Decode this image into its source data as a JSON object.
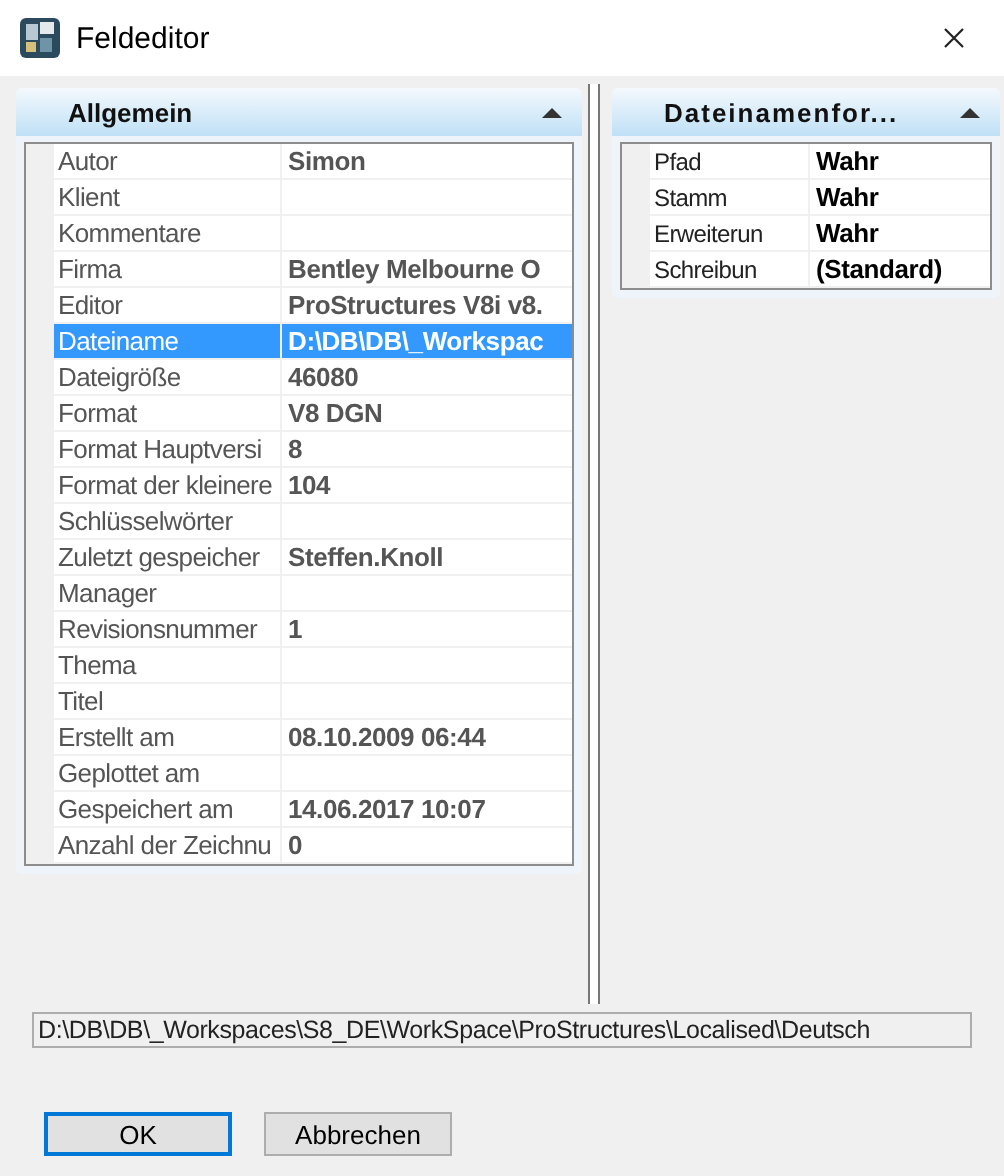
{
  "window": {
    "title": "Feldeditor"
  },
  "panels": [
    {
      "title": "Allgemein",
      "expanded": true,
      "rows": [
        {
          "label": "Autor",
          "value": "Simon",
          "selected": false
        },
        {
          "label": "Klient",
          "value": "",
          "selected": false
        },
        {
          "label": "Kommentare",
          "value": "",
          "selected": false
        },
        {
          "label": "Firma",
          "value": "Bentley Melbourne O",
          "selected": false
        },
        {
          "label": "Editor",
          "value": "ProStructures V8i v8.",
          "selected": false
        },
        {
          "label": "Dateiname",
          "value": "D:\\DB\\DB\\_Workspac",
          "selected": true
        },
        {
          "label": "Dateigröße",
          "value": "46080",
          "selected": false
        },
        {
          "label": "Format",
          "value": "V8 DGN",
          "selected": false
        },
        {
          "label": "Format Hauptversi",
          "value": "8",
          "selected": false
        },
        {
          "label": "Format der kleinere",
          "value": "104",
          "selected": false
        },
        {
          "label": "Schlüsselwörter",
          "value": "",
          "selected": false
        },
        {
          "label": "Zuletzt gespeicher",
          "value": "Steffen.Knoll",
          "selected": false
        },
        {
          "label": "Manager",
          "value": "",
          "selected": false
        },
        {
          "label": "Revisionsnummer",
          "value": "1",
          "selected": false
        },
        {
          "label": "Thema",
          "value": "",
          "selected": false
        },
        {
          "label": "Titel",
          "value": "",
          "selected": false
        },
        {
          "label": "Erstellt am",
          "value": "08.10.2009 06:44",
          "selected": false
        },
        {
          "label": "Geplottet am",
          "value": "",
          "selected": false
        },
        {
          "label": "Gespeichert am",
          "value": "14.06.2017 10:07",
          "selected": false
        },
        {
          "label": "Anzahl der Zeichnu",
          "value": "0",
          "selected": false
        }
      ]
    },
    {
      "title": "Dateinamenfor...",
      "expanded": true,
      "rows": [
        {
          "label": "Pfad",
          "value": "Wahr",
          "selected": false
        },
        {
          "label": "Stamm",
          "value": "Wahr",
          "selected": false
        },
        {
          "label": "Erweiterun",
          "value": "Wahr",
          "selected": false
        },
        {
          "label": "Schreibun",
          "value": "(Standard)",
          "selected": false
        }
      ]
    }
  ],
  "path_field": {
    "value": "D:\\DB\\DB\\_Workspaces\\S8_DE\\WorkSpace\\ProStructures\\Localised\\Deutsch"
  },
  "buttons": [
    {
      "label": "OK",
      "default": true
    },
    {
      "label": "Abbrechen",
      "default": false
    }
  ]
}
